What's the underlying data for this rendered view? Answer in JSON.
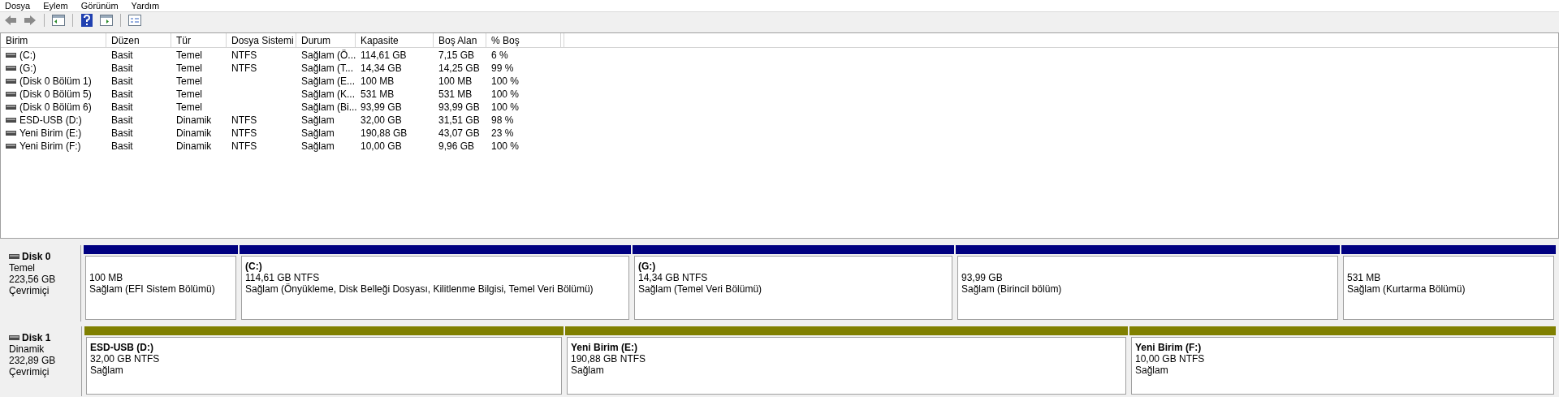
{
  "menu": [
    "Dosya",
    "Eylem",
    "Görünüm",
    "Yardım"
  ],
  "table": {
    "columns": [
      "Birim",
      "Düzen",
      "Tür",
      "Dosya Sistemi",
      "Durum",
      "Kapasite",
      "Boş Alan",
      "% Boş"
    ],
    "rows": [
      [
        "(C:)",
        "Basit",
        "Temel",
        "NTFS",
        "Sağlam (Ö...",
        "114,61 GB",
        "7,15 GB",
        "6 %"
      ],
      [
        "(G:)",
        "Basit",
        "Temel",
        "NTFS",
        "Sağlam (T...",
        "14,34 GB",
        "14,25 GB",
        "99 %"
      ],
      [
        "(Disk 0 Bölüm 1)",
        "Basit",
        "Temel",
        null,
        "Sağlam (E...",
        "100 MB",
        "100 MB",
        "100 %"
      ],
      [
        "(Disk 0 Bölüm 5)",
        "Basit",
        "Temel",
        null,
        "Sağlam (K...",
        "531 MB",
        "531 MB",
        "100 %"
      ],
      [
        "(Disk 0 Bölüm 6)",
        "Basit",
        "Temel",
        null,
        "Sağlam (Bi...",
        "93,99 GB",
        "93,99 GB",
        "100 %"
      ],
      [
        "ESD-USB (D:)",
        "Basit",
        "Dinamik",
        "NTFS",
        "Sağlam",
        "32,00 GB",
        "31,51 GB",
        "98 %"
      ],
      [
        "Yeni Birim (E:)",
        "Basit",
        "Dinamik",
        "NTFS",
        "Sağlam",
        "190,88 GB",
        "43,07 GB",
        "23 %"
      ],
      [
        "Yeni Birim (F:)",
        "Basit",
        "Dinamik",
        "NTFS",
        "Sağlam",
        "10,00 GB",
        "9,96 GB",
        "100 %"
      ]
    ]
  },
  "disks": [
    {
      "name": "Disk 0",
      "type": "Temel",
      "size": "223,56 GB",
      "status": "Çevrimiçi",
      "partitions": [
        {
          "kind": "primary",
          "size": "100 MB",
          "status": "Sağlam (EFI Sistem Bölümü)"
        },
        {
          "kind": "primary",
          "label": "(C:)",
          "size": "114,61 GB NTFS",
          "status": "Sağlam (Önyükleme, Disk Belleği Dosyası, Kilitlenme Bilgisi, Temel Veri Bölümü)"
        },
        {
          "kind": "primary",
          "label": "(G:)",
          "size": "14,34 GB NTFS",
          "status": "Sağlam (Temel Veri Bölümü)"
        },
        {
          "kind": "primary",
          "size": "93,99 GB",
          "status": "Sağlam (Birincil bölüm)"
        },
        {
          "kind": "primary",
          "size": "531 MB",
          "status": "Sağlam (Kurtarma Bölümü)"
        }
      ]
    },
    {
      "name": "Disk 1",
      "type": "Dinamik",
      "size": "232,89 GB",
      "status": "Çevrimiçi",
      "partitions": [
        {
          "kind": "simple",
          "label": "ESD-USB  (D:)",
          "size": "32,00 GB NTFS",
          "status": "Sağlam"
        },
        {
          "kind": "simple",
          "label": "Yeni Birim  (E:)",
          "size": "190,88 GB NTFS",
          "status": "Sağlam"
        },
        {
          "kind": "simple",
          "label": "Yeni Birim  (F:)",
          "size": "10,00 GB NTFS",
          "status": "Sağlam"
        }
      ]
    }
  ]
}
